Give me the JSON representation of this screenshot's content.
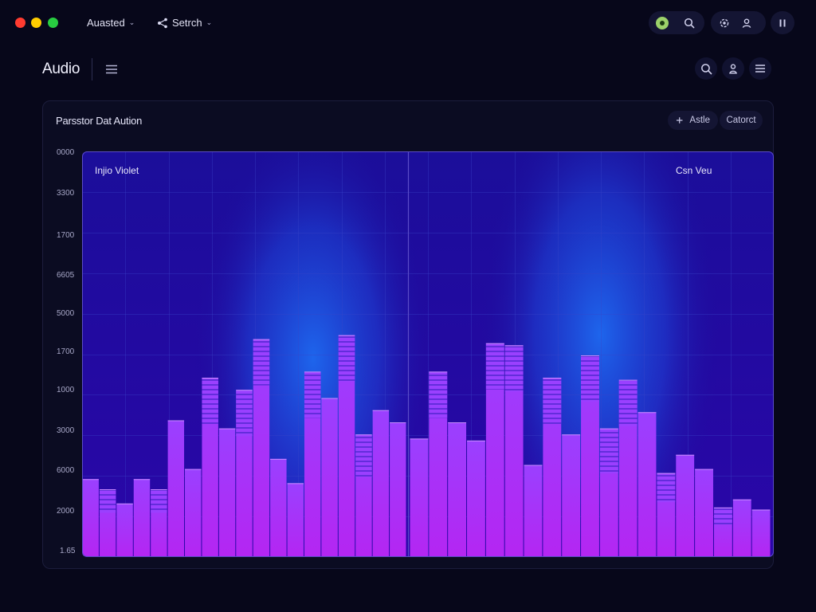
{
  "window": {
    "menus": [
      {
        "label": "Auasted"
      },
      {
        "label": "Setrch"
      }
    ],
    "icons": [
      "status-badge",
      "search-icon",
      "settings-icon",
      "user-icon",
      "pause-icon"
    ]
  },
  "header": {
    "title": "Audio",
    "icons": [
      "menu-icon",
      "search-icon",
      "user-icon",
      "menu-icon"
    ]
  },
  "card": {
    "title": "Parsstor Dat Aution",
    "chips": [
      {
        "label": "Astle",
        "icon": "plus-icon"
      },
      {
        "label": "Catorct"
      }
    ]
  },
  "chart_data": {
    "type": "bar",
    "ytick_labels": [
      "0000",
      "3300",
      "1700",
      "6605",
      "5000",
      "1700",
      "1000",
      "3000",
      "6000",
      "2000",
      "1.65"
    ],
    "left_label": "Injio Violet",
    "right_label": "Csn Veu",
    "left_panel_values": [
      19,
      16.5,
      13,
      19,
      16.5,
      33.5,
      21.5,
      44,
      31.5,
      41,
      53.5,
      24,
      18,
      45.5,
      39,
      54.5,
      30,
      36,
      33
    ],
    "right_panel_values": [
      29,
      45.5,
      33,
      28.5,
      52.5,
      52,
      22.5,
      44,
      30,
      49.5,
      31.5,
      43.5,
      35.5,
      20.5,
      25,
      21.5,
      12,
      14,
      11.5
    ],
    "colors": {
      "bar": "#b426f2",
      "bar_top": "#9a40ff",
      "plot_bg": "#170a8c",
      "glow": "#1e6af0",
      "axis_line": "#5a4cc8"
    }
  }
}
